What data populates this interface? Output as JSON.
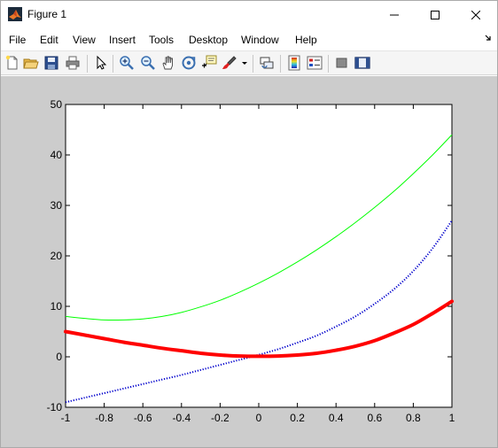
{
  "window": {
    "title": "Figure 1",
    "controls": [
      "minimize",
      "maximize",
      "close"
    ]
  },
  "menu": {
    "items": [
      "File",
      "Edit",
      "View",
      "Insert",
      "Tools",
      "Desktop",
      "Window",
      "Help"
    ]
  },
  "toolbar": {
    "buttons": [
      "new-figure-icon",
      "open-file-icon",
      "save-figure-icon",
      "print-figure-icon",
      "edit-plot-arrow-icon",
      "zoom-in-icon",
      "zoom-out-icon",
      "pan-hand-icon",
      "rotate-3d-icon",
      "data-cursor-icon",
      "brush-icon",
      "brush-dropdown-icon",
      "link-plot-icon",
      "insert-colorbar-icon",
      "insert-legend-icon",
      "hide-plot-tools-icon",
      "show-plot-tools-icon"
    ]
  },
  "chart_data": {
    "type": "line",
    "xlim": [
      -1,
      1
    ],
    "ylim": [
      -10,
      50
    ],
    "x_ticks": [
      -1,
      -0.8,
      -0.6,
      -0.4,
      -0.2,
      0,
      0.2,
      0.4,
      0.6,
      0.8,
      1
    ],
    "x_tick_labels": [
      "-1",
      "-0.8",
      "-0.6",
      "-0.4",
      "-0.2",
      "0",
      "0.2",
      "0.4",
      "0.6",
      "0.8",
      "1"
    ],
    "y_ticks": [
      -10,
      0,
      10,
      20,
      30,
      40,
      50
    ],
    "y_tick_labels": [
      "-10",
      "0",
      "10",
      "20",
      "30",
      "40",
      "50"
    ],
    "grid": false,
    "series": [
      {
        "color": "#00ff00",
        "style": "solid-thin",
        "x": [
          -1,
          -0.9,
          -0.8,
          -0.7,
          -0.6,
          -0.5,
          -0.4,
          -0.3,
          -0.2,
          -0.1,
          0,
          0.1,
          0.2,
          0.3,
          0.4,
          0.5,
          0.6,
          0.7,
          0.8,
          0.9,
          1
        ],
        "y": [
          8.0,
          7.6,
          7.3,
          7.3,
          7.5,
          8.0,
          8.8,
          9.9,
          11.2,
          12.8,
          14.6,
          16.6,
          18.8,
          21.2,
          23.8,
          26.6,
          29.6,
          32.8,
          36.3,
          40.0,
          44.0
        ]
      },
      {
        "color": "#0000cc",
        "style": "dotted",
        "x": [
          -1,
          -0.9,
          -0.8,
          -0.7,
          -0.6,
          -0.5,
          -0.4,
          -0.3,
          -0.2,
          -0.1,
          0,
          0.1,
          0.2,
          0.3,
          0.4,
          0.5,
          0.6,
          0.7,
          0.8,
          0.9,
          1
        ],
        "y": [
          -9.0,
          -8.1,
          -7.2,
          -6.3,
          -5.4,
          -4.5,
          -3.6,
          -2.6,
          -1.6,
          -0.6,
          0.4,
          1.5,
          2.8,
          4.2,
          6.0,
          8.0,
          10.5,
          13.4,
          17.0,
          21.5,
          27.0
        ]
      },
      {
        "color": "#ff0000",
        "style": "solid-thick",
        "x": [
          -1,
          -0.9,
          -0.8,
          -0.7,
          -0.6,
          -0.5,
          -0.4,
          -0.3,
          -0.2,
          -0.1,
          0,
          0.1,
          0.2,
          0.3,
          0.4,
          0.5,
          0.6,
          0.7,
          0.8,
          0.9,
          1
        ],
        "y": [
          5.0,
          4.3,
          3.6,
          2.9,
          2.3,
          1.7,
          1.2,
          0.7,
          0.35,
          0.15,
          0.1,
          0.15,
          0.35,
          0.7,
          1.3,
          2.1,
          3.2,
          4.7,
          6.4,
          8.6,
          11.0
        ]
      }
    ]
  }
}
